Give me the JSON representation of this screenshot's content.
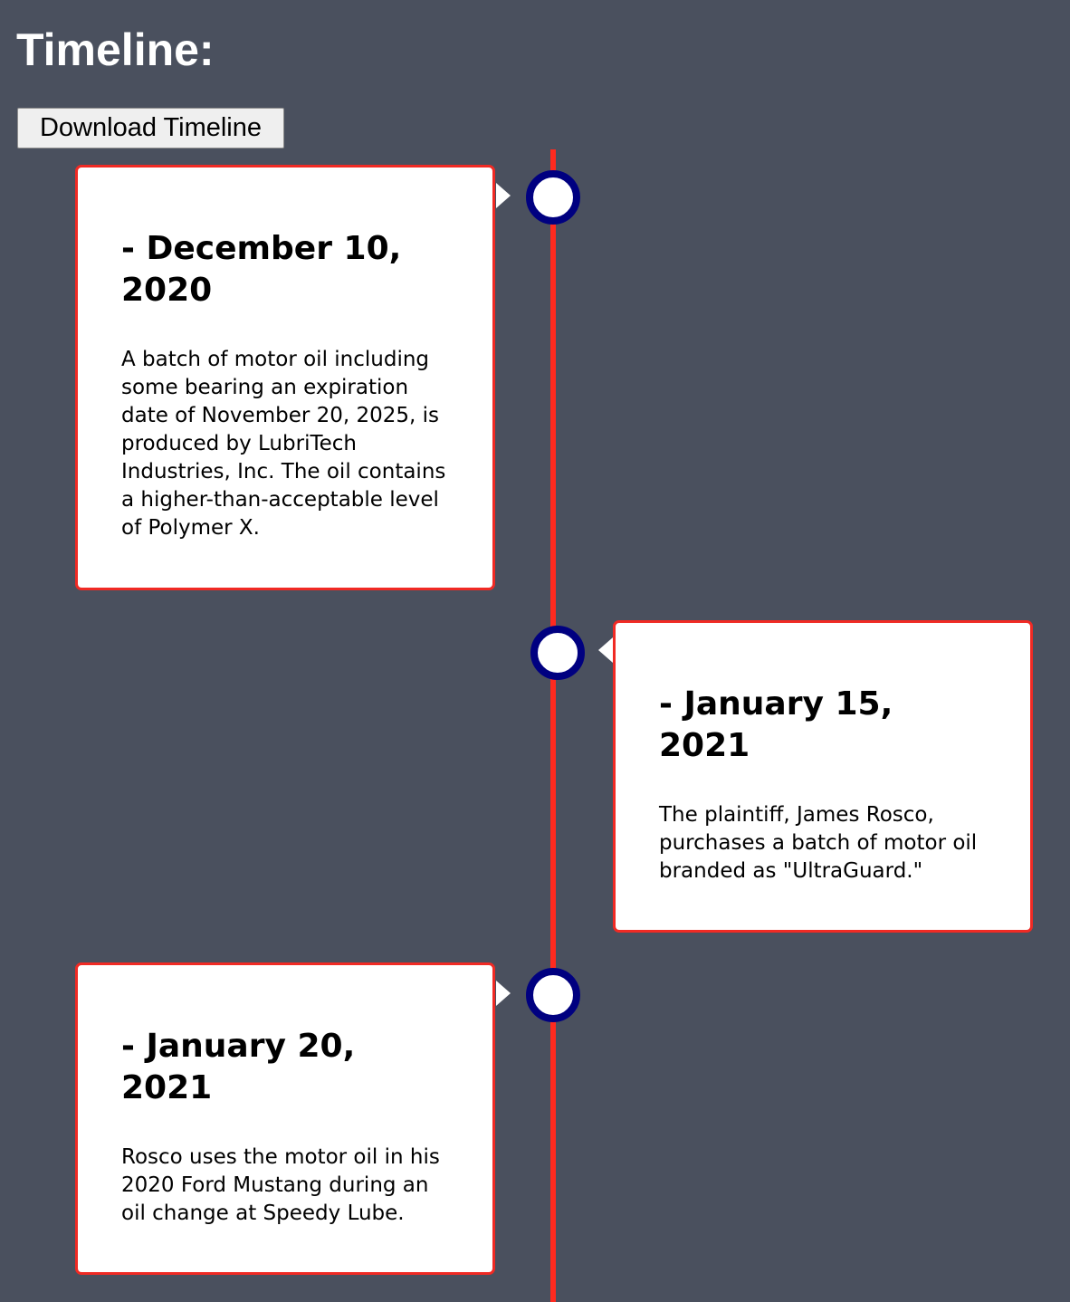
{
  "title": "Timeline:",
  "download_button": "Download Timeline",
  "events": [
    {
      "date": "- December 10, 2020",
      "text": "A batch of motor oil including some bearing an expiration date of November 20, 2025, is produced by LubriTech Industries, Inc. The oil contains a higher-than-acceptable level of Polymer X."
    },
    {
      "date": "- January 15, 2021",
      "text": "The plaintiff, James Rosco, purchases a batch of motor oil branded as \"UltraGuard.\""
    },
    {
      "date": "- January 20, 2021",
      "text": "Rosco uses the motor oil in his 2020 Ford Mustang during an oil change at Speedy Lube."
    }
  ],
  "colors": {
    "background": "#4a505e",
    "line": "#ff2a1f",
    "card_border": "#f02a24",
    "node_ring": "#000080"
  }
}
